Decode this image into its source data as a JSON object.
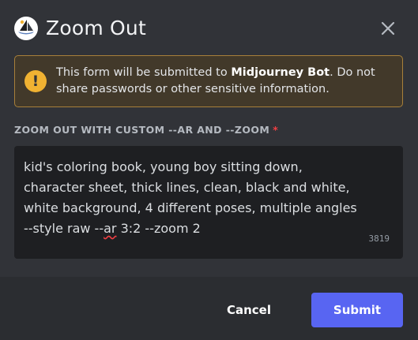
{
  "modal": {
    "title": "Zoom Out",
    "bot_avatar_icon": "sailboat-icon"
  },
  "warning": {
    "icon": "exclamation-icon",
    "text_before": "This form will be submitted to ",
    "bot_name": "Midjourney Bot",
    "text_after": ". Do not share passwords or other sensitive information."
  },
  "field": {
    "label": "ZOOM OUT WITH CUSTOM --AR AND --ZOOM",
    "required_marker": "*",
    "lines": [
      "kid's coloring book, young boy sitting down,",
      "character sheet, thick lines, clean, black and white,",
      "white background, 4 different poses, multiple angles"
    ],
    "last_line_prefix": "--style raw --",
    "last_line_misspelled": "ar",
    "last_line_suffix": " 3:2 --zoom 2",
    "char_count": "3819"
  },
  "footer": {
    "cancel_label": "Cancel",
    "submit_label": "Submit"
  },
  "colors": {
    "background": "#313338",
    "footer": "#2b2d31",
    "accent": "#5865f2",
    "warning_border": "#a8803a",
    "warning_icon": "#f0b232",
    "required": "#f23f43"
  }
}
